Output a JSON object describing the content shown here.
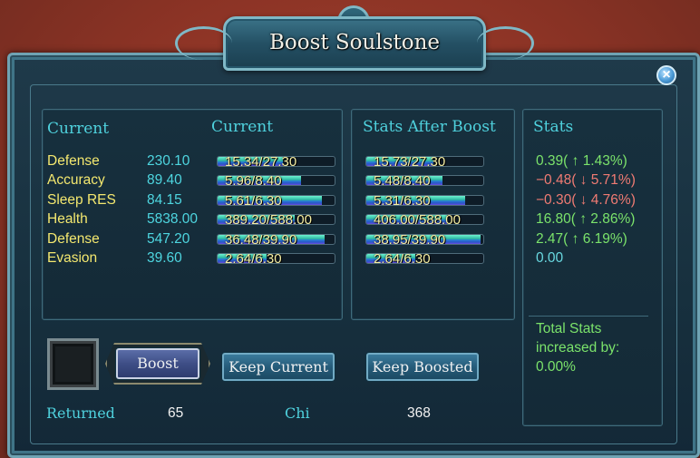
{
  "window": {
    "title": "Boost Soulstone",
    "close_glyph": "×"
  },
  "headers": {
    "current_labels": "Current",
    "current_bars": "Current",
    "after_boost": "Stats After Boost",
    "stats": "Stats"
  },
  "rows": [
    {
      "label": "Defense",
      "value": "230.10",
      "current": "15.34/27.30",
      "current_fill": 0.562,
      "after": "15.73/27.30",
      "after_fill": 0.576,
      "stat": "0.39( ↑ 1.43%)",
      "stat_kind": "pos"
    },
    {
      "label": "Accuracy",
      "value": "89.40",
      "current": "5.96/8.40",
      "current_fill": 0.71,
      "after": "5.48/8.40",
      "after_fill": 0.652,
      "stat": "−0.48( ↓ 5.71%)",
      "stat_kind": "neg"
    },
    {
      "label": "Sleep RES",
      "value": "84.15",
      "current": "5.61/6.30",
      "current_fill": 0.89,
      "after": "5.31/6.30",
      "after_fill": 0.843,
      "stat": "−0.30( ↓ 4.76%)",
      "stat_kind": "neg"
    },
    {
      "label": "Health",
      "value": "5838.00",
      "current": "389.20/588.00",
      "current_fill": 0.662,
      "after": "406.00/588.00",
      "after_fill": 0.69,
      "stat": "16.80( ↑ 2.86%)",
      "stat_kind": "pos"
    },
    {
      "label": "Defense",
      "value": "547.20",
      "current": "36.48/39.90",
      "current_fill": 0.914,
      "after": "38.95/39.90",
      "after_fill": 0.976,
      "stat": "2.47( ↑ 6.19%)",
      "stat_kind": "pos"
    },
    {
      "label": "Evasion",
      "value": "39.60",
      "current": "2.64/6.30",
      "current_fill": 0.419,
      "after": "2.64/6.30",
      "after_fill": 0.419,
      "stat": "0.00",
      "stat_kind": "zero"
    }
  ],
  "total": {
    "line1": "Total Stats",
    "line2": "increased by:",
    "line3": "0.00%"
  },
  "buttons": {
    "boost": "Boost",
    "keep_current": "Keep Current",
    "keep_boosted": "Keep Boosted"
  },
  "footer": {
    "returned_label": "Returned",
    "returned_value": "65",
    "chi_label": "Chi",
    "chi_value": "368"
  },
  "colors": {
    "header": "#4fd1dd",
    "label": "#f4e86f",
    "value": "#4ed6e0",
    "positive": "#7be36b",
    "negative": "#f07b73"
  }
}
